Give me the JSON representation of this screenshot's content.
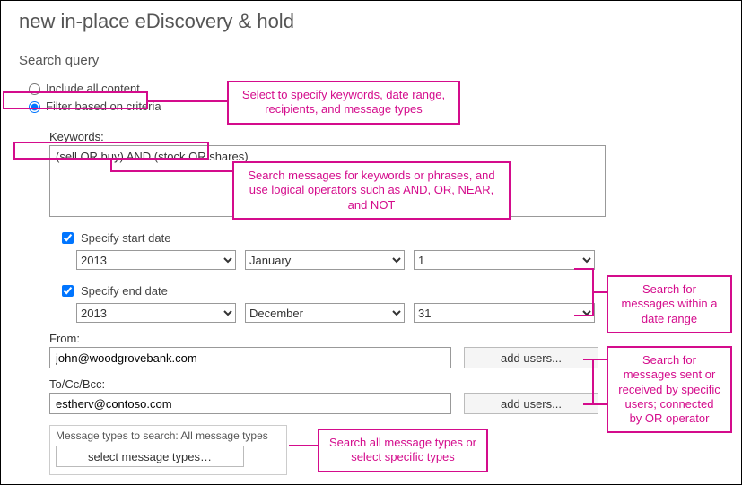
{
  "page_title": "new in-place eDiscovery & hold",
  "section_title": "Search query",
  "radios": {
    "include_all": "Include all content",
    "filter": "Filter based on criteria"
  },
  "callouts": {
    "filter": "Select to specify keywords, date range, recipients, and message types",
    "keywords": "Search messages for keywords or phrases, and use logical operators such as AND, OR, NEAR, and NOT",
    "dates": "Search for messages within a date range",
    "users": "Search for messages sent or received by specific users; connected by OR operator",
    "types": "Search all message types or select specific types"
  },
  "keywords": {
    "label": "Keywords:",
    "value": "(sell OR buy) AND (stock OR shares)"
  },
  "start_date": {
    "check_label": "Specify start date",
    "year": "2013",
    "month": "January",
    "day": "1"
  },
  "end_date": {
    "check_label": "Specify end date",
    "year": "2013",
    "month": "December",
    "day": "31"
  },
  "from": {
    "label": "From:",
    "value": "john@woodgrovebank.com",
    "btn": "add users..."
  },
  "to": {
    "label": "To/Cc/Bcc:",
    "value": "estherv@contoso.com",
    "btn": "add users..."
  },
  "msg_types": {
    "label": "Message types to search:  All message types",
    "btn": "select message types…"
  }
}
